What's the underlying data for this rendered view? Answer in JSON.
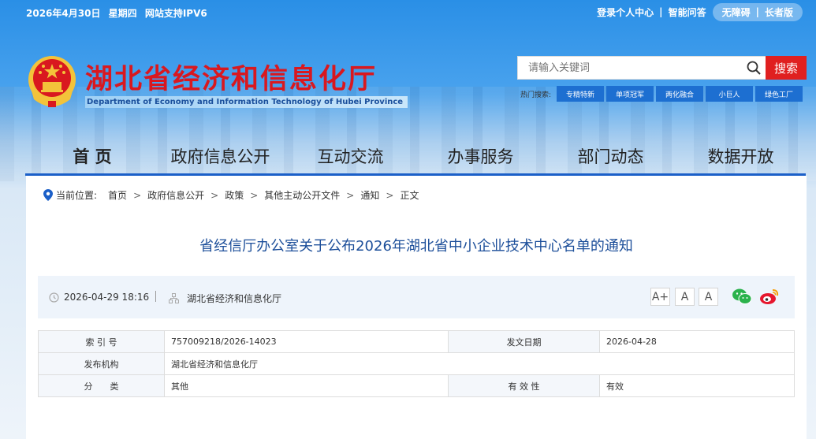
{
  "topbar": {
    "date": "2026年4月30日",
    "weekday": "星期四",
    "ipv6": "网站支持IPV6",
    "login": "登录个人中心",
    "qa": "智能问答",
    "accessible": "无障碍",
    "elder": "长者版"
  },
  "header": {
    "title": "湖北省经济和信息化厅",
    "subtitle": "Department of Economy and Information Technology of Hubei Province"
  },
  "search": {
    "placeholder": "请输入关键词",
    "button": "搜索",
    "hot_label": "热门搜索:",
    "hot_tags": [
      "专精特新",
      "单项冠军",
      "两化融合",
      "小巨人",
      "绿色工厂"
    ]
  },
  "nav": {
    "items": [
      "首 页",
      "政府信息公开",
      "互动交流",
      "办事服务",
      "部门动态",
      "数据开放"
    ]
  },
  "breadcrumb": {
    "label": "当前位置:",
    "items": [
      "首页",
      "政府信息公开",
      "政策",
      "其他主动公开文件",
      "通知",
      "正文"
    ]
  },
  "article": {
    "title": "省经信厅办公室关于公布2026年湖北省中小企业技术中心名单的通知",
    "datetime": "2026-04-29 18:16",
    "source": "湖北省经济和信息化厅",
    "font_sizes": [
      "A+",
      "A",
      "A"
    ]
  },
  "info_table": {
    "index_label": "索 引 号",
    "index_value": "757009218/2026-14023",
    "date_label": "发文日期",
    "date_value": "2026-04-28",
    "org_label": "发布机构",
    "org_value": "湖北省经济和信息化厅",
    "category_label": "分　　类",
    "category_value": "其他",
    "valid_label": "有 效 性",
    "valid_value": "有效"
  }
}
